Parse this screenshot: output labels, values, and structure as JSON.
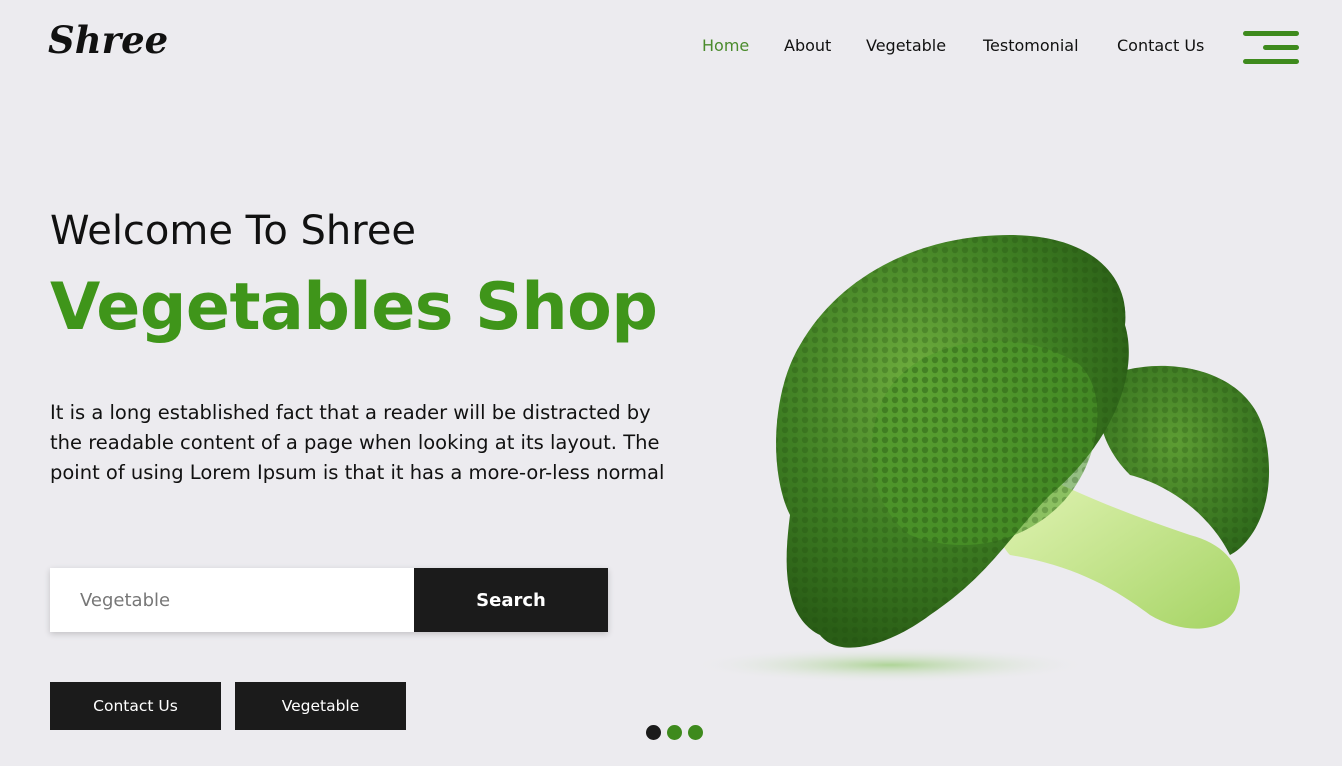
{
  "brand": {
    "logo": "Shree"
  },
  "nav": {
    "items": [
      {
        "label": "Home",
        "active": true
      },
      {
        "label": "About",
        "active": false
      },
      {
        "label": "Vegetable",
        "active": false
      },
      {
        "label": "Testomonial",
        "active": false
      },
      {
        "label": "Contact Us",
        "active": false
      }
    ],
    "menu_icon": "hamburger-menu-icon"
  },
  "hero": {
    "welcome": "Welcome To Shree",
    "headline": "Vegetables Shop",
    "paragraph": "It is a long established fact that a reader will be distracted by the readable content of a page when looking at its layout. The point of using Lorem Ipsum is that it has a more-or-less normal",
    "search": {
      "placeholder": "Vegetable",
      "value": "",
      "button_label": "Search"
    },
    "buttons": {
      "contact_label": "Contact Us",
      "vegetable_label": "Vegetable"
    },
    "image": "broccoli-image"
  },
  "carousel": {
    "slides": 3,
    "active_index": 0
  },
  "colors": {
    "accent": "#3f951a",
    "dark": "#1b1b1b",
    "background": "#ecebef",
    "active_nav": "#4a8b2c"
  }
}
